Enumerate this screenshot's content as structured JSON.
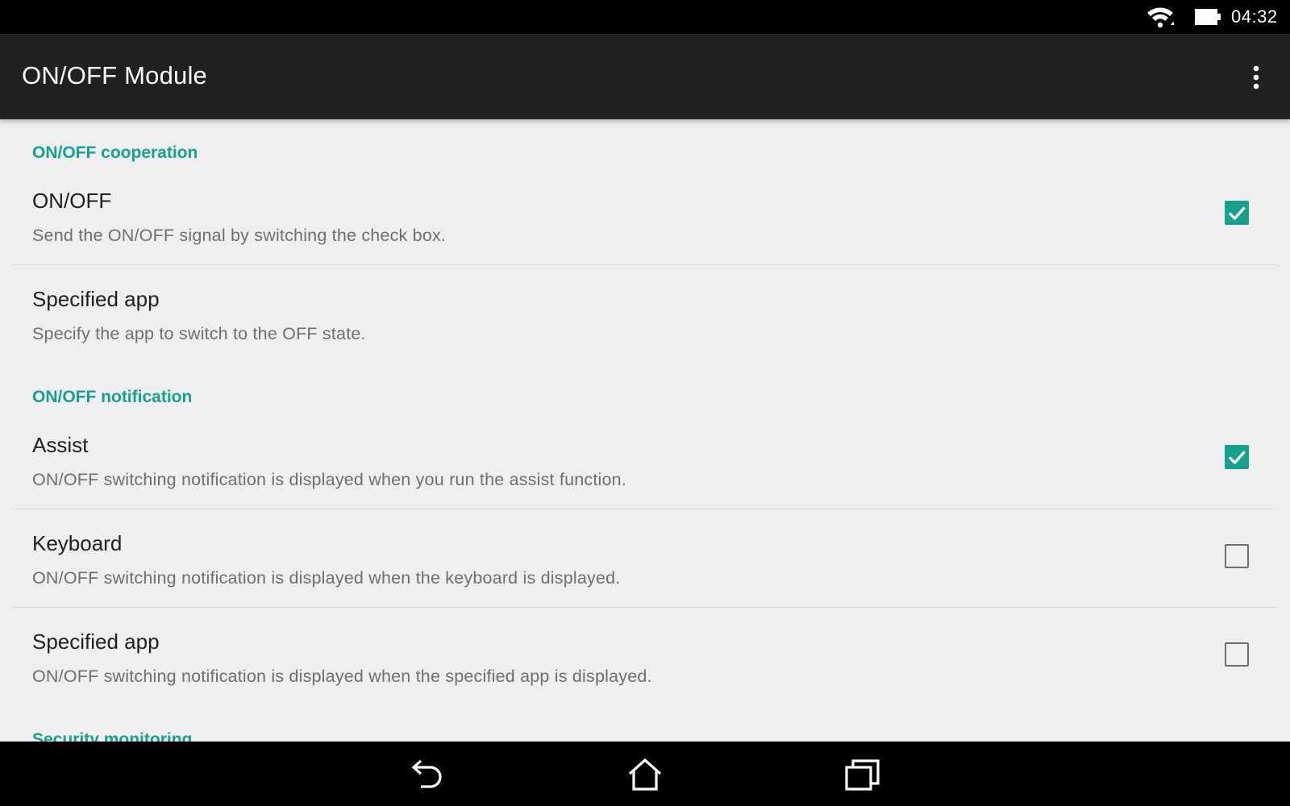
{
  "status_bar": {
    "time": "04:32",
    "icons": [
      "wifi-icon",
      "battery-icon"
    ]
  },
  "app_bar": {
    "title": "ON/OFF Module",
    "overflow_icon": "more-vert-icon"
  },
  "colors": {
    "accent": "#16a08d",
    "app_bar": "#212023",
    "background": "#efeff1"
  },
  "sections": [
    {
      "header": "ON/OFF cooperation",
      "items": [
        {
          "title": "ON/OFF",
          "summary": "Send the ON/OFF signal by switching the check box.",
          "checkbox": true,
          "checked": true
        },
        {
          "title": "Specified app",
          "summary": "Specify the app to switch to the OFF state.",
          "checkbox": false
        }
      ]
    },
    {
      "header": "ON/OFF notification",
      "items": [
        {
          "title": "Assist",
          "summary": "ON/OFF switching notification is displayed when you run the assist function.",
          "checkbox": true,
          "checked": true
        },
        {
          "title": "Keyboard",
          "summary": "ON/OFF switching notification is displayed when the keyboard is displayed.",
          "checkbox": true,
          "checked": false
        },
        {
          "title": "Specified app",
          "summary": "ON/OFF switching notification is displayed when the specified app is displayed.",
          "checkbox": true,
          "checked": false
        }
      ]
    },
    {
      "header": "Security monitoring",
      "items": []
    }
  ],
  "nav_bar": {
    "buttons": [
      "back-icon",
      "home-icon",
      "recents-icon"
    ]
  }
}
